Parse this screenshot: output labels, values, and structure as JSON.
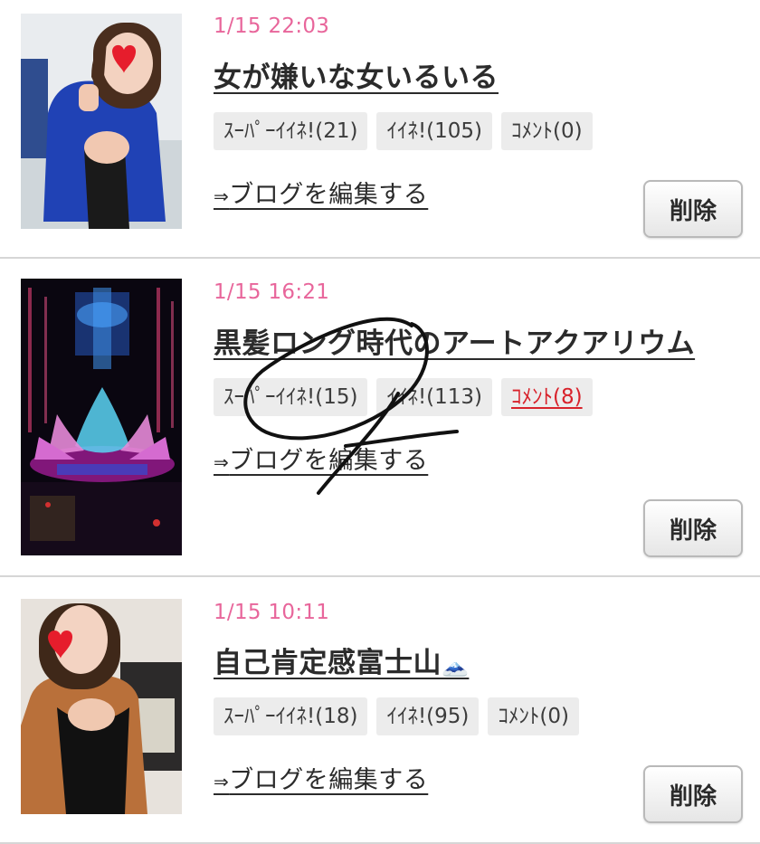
{
  "entries": [
    {
      "date": "1/15 22:03",
      "title": "女が嫌いな女いるいる",
      "badges": {
        "super_like": "ｽｰﾊﾟｰｲｲﾈ!(21)",
        "like": "ｲｲﾈ!(105)",
        "comment": "ｺﾒﾝﾄ(0)"
      },
      "edit_link_arrow": "⇒",
      "edit_link": "ブログを編集する",
      "delete": "削除"
    },
    {
      "date": "1/15 16:21",
      "title": "黒髪ロング時代のアートアクアリウム",
      "badges": {
        "super_like": "ｽｰﾊﾟｰｲｲﾈ!(15)",
        "like": "ｲｲﾈ!(113)",
        "comment": "ｺﾒﾝﾄ(8)"
      },
      "edit_link_arrow": "⇒",
      "edit_link": "ブログを編集する",
      "delete": "削除"
    },
    {
      "date": "1/15 10:11",
      "title": "自己肯定感富士山",
      "title_emoji": "🗻",
      "badges": {
        "super_like": "ｽｰﾊﾟｰｲｲﾈ!(18)",
        "like": "ｲｲﾈ!(95)",
        "comment": "ｺﾒﾝﾄ(0)"
      },
      "edit_link_arrow": "⇒",
      "edit_link": "ブログを編集する",
      "delete": "削除"
    }
  ],
  "colors": {
    "date": "#e8669b",
    "comment_active": "#d8222b",
    "badge_bg": "#ececec",
    "divider": "#d6d6d6"
  }
}
